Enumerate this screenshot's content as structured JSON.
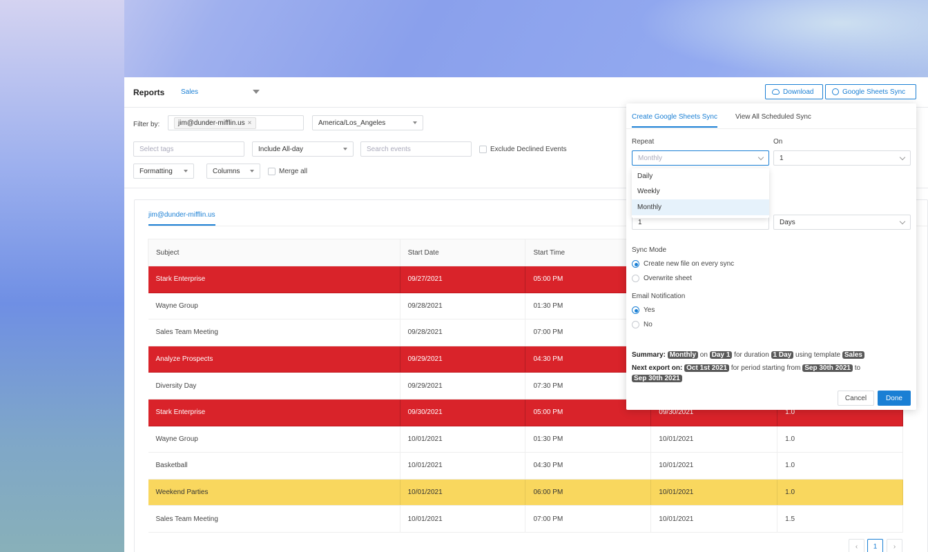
{
  "header": {
    "title": "Reports",
    "report_select": "Sales",
    "download_label": "Download",
    "gsync_label": "Google Sheets Sync"
  },
  "filters": {
    "filter_by_label": "Filter by:",
    "user_tag": "jim@dunder-mifflin.us",
    "timezone": "America/Los_Angeles",
    "tags_placeholder": "Select tags",
    "allday": "Include All-day",
    "search_placeholder": "Search events",
    "exclude_declined": "Exclude Declined Events",
    "formatting": "Formatting",
    "columns": "Columns",
    "merge_all": "Merge all"
  },
  "content": {
    "user_tab": "jim@dunder-mifflin.us",
    "columns": [
      "Subject",
      "Start Date",
      "Start Time",
      "",
      ""
    ],
    "rows": [
      {
        "subject": "Stark Enterprise",
        "start_date": "09/27/2021",
        "start_time": "05:00 PM",
        "c4": "",
        "c5": "",
        "color": "red"
      },
      {
        "subject": "Wayne Group",
        "start_date": "09/28/2021",
        "start_time": "01:30 PM",
        "c4": "",
        "c5": "",
        "color": ""
      },
      {
        "subject": "Sales Team Meeting",
        "start_date": "09/28/2021",
        "start_time": "07:00 PM",
        "c4": "",
        "c5": "",
        "color": ""
      },
      {
        "subject": "Analyze Prospects",
        "start_date": "09/29/2021",
        "start_time": "04:30 PM",
        "c4": "",
        "c5": "",
        "color": "red"
      },
      {
        "subject": "Diversity Day",
        "start_date": "09/29/2021",
        "start_time": "07:30 PM",
        "c4": "",
        "c5": "",
        "color": ""
      },
      {
        "subject": "Stark Enterprise",
        "start_date": "09/30/2021",
        "start_time": "05:00 PM",
        "c4": "09/30/2021",
        "c5": "1.0",
        "color": "red"
      },
      {
        "subject": "Wayne Group",
        "start_date": "10/01/2021",
        "start_time": "01:30 PM",
        "c4": "10/01/2021",
        "c5": "1.0",
        "color": ""
      },
      {
        "subject": "Basketball",
        "start_date": "10/01/2021",
        "start_time": "04:30 PM",
        "c4": "10/01/2021",
        "c5": "1.0",
        "color": ""
      },
      {
        "subject": "Weekend Parties",
        "start_date": "10/01/2021",
        "start_time": "06:00 PM",
        "c4": "10/01/2021",
        "c5": "1.0",
        "color": "yellow"
      },
      {
        "subject": "Sales Team Meeting",
        "start_date": "10/01/2021",
        "start_time": "07:00 PM",
        "c4": "10/01/2021",
        "c5": "1.5",
        "color": ""
      }
    ],
    "pager": {
      "prev": "‹",
      "current": "1",
      "next": "›"
    }
  },
  "popup": {
    "tab_create": "Create Google Sheets Sync",
    "tab_view": "View All Scheduled Sync",
    "repeat_label": "Repeat",
    "repeat_value": "Monthly",
    "on_label": "On",
    "on_value": "1",
    "repeat_options": [
      "Daily",
      "Weekly",
      "Monthly"
    ],
    "duration_value": "1",
    "duration_unit": "Days",
    "sync_mode_label": "Sync Mode",
    "sync_mode_options": [
      "Create new file on every sync",
      "Overwrite sheet"
    ],
    "email_label": "Email Notification",
    "email_options": [
      "Yes",
      "No"
    ],
    "summary": {
      "label": "Summary:",
      "repeat": "Monthly",
      "on_word": "on",
      "day": "Day 1",
      "for_duration": "for duration",
      "duration": "1 Day",
      "using_template": "using template",
      "template": "Sales",
      "next_label": "Next export on:",
      "next_date": "Oct 1st 2021",
      "period_text": "for period starting from",
      "period_start": "Sep 30th 2021",
      "to_word": "to",
      "period_end": "Sep 30th 2021"
    },
    "cancel": "Cancel",
    "done": "Done"
  },
  "colors": {
    "accent": "#1a7fd4",
    "red_row": "#d9232a",
    "yellow_row": "#f9d75e"
  }
}
